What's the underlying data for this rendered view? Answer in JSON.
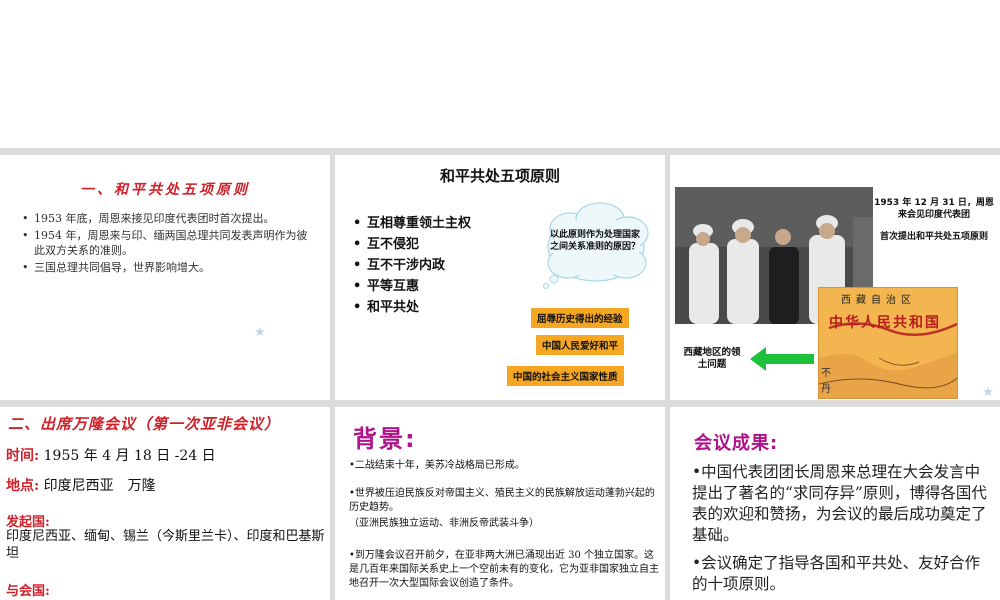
{
  "panel1": {
    "title": "一、和平共处五项原则",
    "bullets": [
      "1953 年底，周恩来接见印度代表团时首次提出。",
      "1954 年，周恩来与印、缅两国总理共同发表声明作为彼此双方关系的准则。",
      "三国总理共同倡导，世界影响增大。"
    ]
  },
  "panel2": {
    "title": "和平共处五项原则",
    "principles": [
      "互相尊重领土主权",
      "互不侵犯",
      "互不干涉内政",
      "平等互惠",
      "和平共处"
    ],
    "cloud_text": "以此原则作为处理国家之间关系准则的原因？",
    "tags": [
      "屈辱历史得出的经验",
      "中国人民爱好和平",
      "中国的社会主义国家性质"
    ]
  },
  "panel3": {
    "caption_1": "1953 年 12 月 31 日，周恩来会见印度代表团",
    "caption_2": "首次提出和平共处五项原则",
    "map_title": "西藏自治区",
    "map_banner": "中华人民共和国",
    "map_label_1": "不",
    "map_label_2": "丹",
    "tibet_label": "西藏地区的领土问题"
  },
  "panel4": {
    "title": "二、出席万隆会议（第一次亚非会议）",
    "time_label": "时间:",
    "time_value": "1955 年 4 月 18 日 -24 日",
    "place_label": "地点:",
    "place_value": "印度尼西亚　万隆",
    "initiators_label": "发起国:",
    "initiators_value": "印度尼西亚、缅甸、锡兰（今斯里兰卡）、印度和巴基斯坦",
    "participants_label": "与会国:"
  },
  "panel5": {
    "title": "背景:",
    "paragraphs": [
      "•二战结束十年，美苏冷战格局已形成。",
      "•世界被压迫民族反对帝国主义、殖民主义的民族解放运动蓬勃兴起的历史趋势。",
      "（亚洲民族独立运动、非洲反帝武装斗争）",
      "•到万隆会议召开前夕，在亚非两大洲已涌现出近 30 个独立国家。这是几百年来国际关系史上一个空前未有的变化，它为亚非国家独立自主地召开一次大型国际会议创造了条件。"
    ]
  },
  "panel6": {
    "title": "会议成果:",
    "paragraphs": [
      "•中国代表团团长周恩来总理在大会发言中提出了著名的“求同存异”原则，博得各国代表的欢迎和赞扬，为会议的最后成功奠定了基础。",
      "•会议确定了指导各国和平共处、友好合作的十项原则。"
    ]
  },
  "colors": {
    "red": "#d0202a",
    "magenta": "#b0128a",
    "orange": "#f5a623",
    "green": "#1fc13a"
  }
}
